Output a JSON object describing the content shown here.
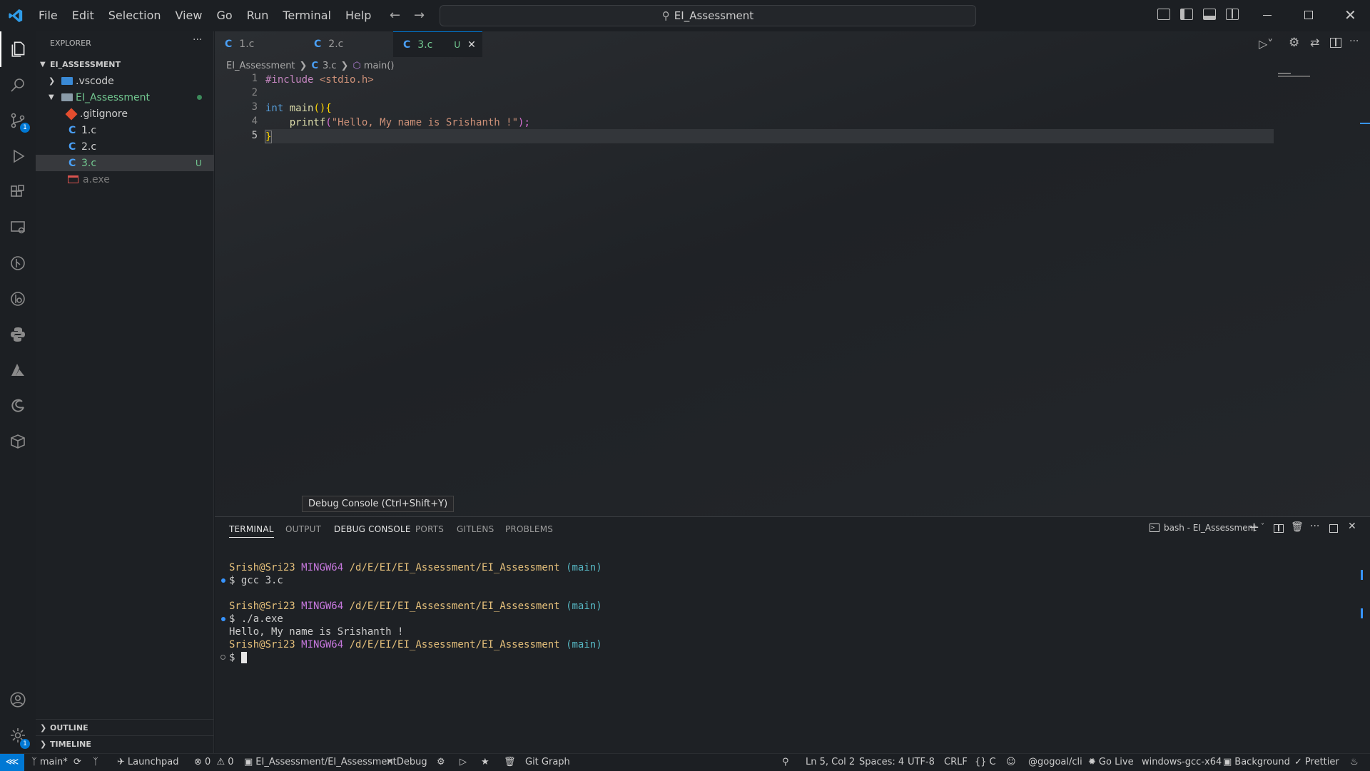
{
  "menu": [
    "File",
    "Edit",
    "Selection",
    "View",
    "Go",
    "Run",
    "Terminal",
    "Help"
  ],
  "command_center": "EI_Assessment",
  "explorer": {
    "title": "EXPLORER",
    "root": "EI_ASSESSMENT",
    "items": [
      {
        "label": ".vscode",
        "type": "folder"
      },
      {
        "label": "EI_Assessment",
        "type": "folder-open"
      },
      {
        "label": ".gitignore",
        "type": "git"
      },
      {
        "label": "1.c",
        "type": "c"
      },
      {
        "label": "2.c",
        "type": "c"
      },
      {
        "label": "3.c",
        "type": "c",
        "badge": "U"
      },
      {
        "label": "a.exe",
        "type": "exe"
      }
    ],
    "outline": "OUTLINE",
    "timeline": "TIMELINE"
  },
  "tabs": [
    {
      "label": "1.c"
    },
    {
      "label": "2.c"
    },
    {
      "label": "3.c",
      "badge": "U"
    }
  ],
  "breadcrumb": {
    "folder": "EI_Assessment",
    "file": "3.c",
    "symbol": "main()"
  },
  "code": {
    "line_numbers": [
      "1",
      "2",
      "3",
      "4",
      "5"
    ],
    "l1_directive": "#include",
    "l1_header": "<stdio.h>",
    "l3_type": "int",
    "l3_func": "main",
    "l3_punct": "(){",
    "l4_func": "printf",
    "l4_open": "(",
    "l4_string": "\"Hello, My name is Srishanth !\"",
    "l4_close": ");",
    "l5_brace": "}"
  },
  "tooltip": "Debug Console (Ctrl+Shift+Y)",
  "panel": {
    "tabs": [
      "TERMINAL",
      "OUTPUT",
      "DEBUG CONSOLE",
      "PORTS",
      "GITLENS",
      "PROBLEMS"
    ],
    "terminal_name": "bash - EI_Assessment",
    "user": "Srish@Sri23",
    "env": "MINGW64",
    "path": "/d/E/EI/EI_Assessment/EI_Assessment",
    "branch": "(main)",
    "cmd1": "$ gcc 3.c",
    "cmd2": "$ ./a.exe",
    "output": "Hello, My name is Srishanth !",
    "prompt": "$ "
  },
  "status": {
    "branch": "main*",
    "launchpad": "Launchpad",
    "errors": "0",
    "warnings": "0",
    "workspace": "EI_Assessment/EI_Assessment",
    "debug": "Debug",
    "gitgraph": "Git Graph",
    "position": "Ln 5, Col 2",
    "spaces": "Spaces: 4",
    "encoding": "UTF-8",
    "eol": "CRLF",
    "language": "C",
    "account": "@gogoal/cli",
    "golive": "Go Live",
    "config": "windows-gcc-x64",
    "background": "Background",
    "prettier": "Prettier"
  },
  "colors": {
    "accent": "#0078d4",
    "git_badge": "#73c991",
    "prompt_user": "#e5c07b",
    "prompt_env": "#c678dd",
    "prompt_branch": "#56b6c2"
  }
}
